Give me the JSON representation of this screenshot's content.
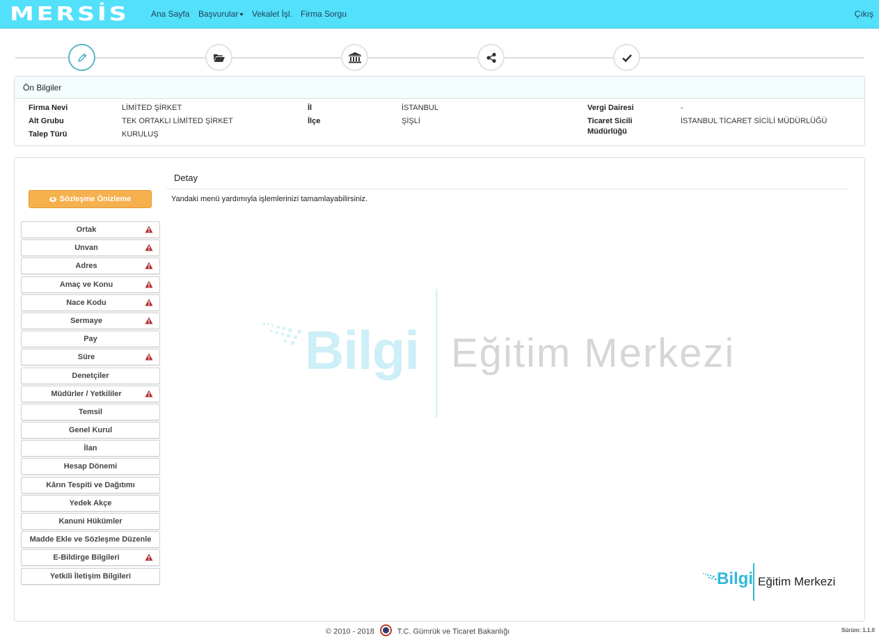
{
  "nav": {
    "logo": "MERSİS",
    "items": [
      "Ana Sayfa",
      "Başvurular",
      "Vekalet İşl.",
      "Firma Sorgu"
    ],
    "logout": "Çıkış"
  },
  "steps": [
    {
      "icon": "pencil-icon",
      "active": true
    },
    {
      "icon": "folder-open-icon",
      "active": false
    },
    {
      "icon": "bank-icon",
      "active": false
    },
    {
      "icon": "share-icon",
      "active": false
    },
    {
      "icon": "check-icon",
      "active": false
    }
  ],
  "on_bilgiler": {
    "title": "Ön Bilgiler",
    "firma_nevi_label": "Firma Nevi",
    "firma_nevi": "LİMİTED ŞİRKET",
    "alt_grubu_label": "Alt Grubu",
    "alt_grubu": "TEK ORTAKLI LİMİTED ŞİRKET",
    "talep_turu_label": "Talep Türü",
    "talep_turu": "KURULUŞ",
    "il_label": "İl",
    "il": "İSTANBUL",
    "ilce_label": "İlçe",
    "ilce": "ŞİŞLİ",
    "vergi_dairesi_label": "Vergi Dairesi",
    "vergi_dairesi": "-",
    "ticaret_sicili_label_1": "Ticaret Sicili",
    "ticaret_sicili_label_2": "Müdürlüğü",
    "ticaret_sicili": "İSTANBUL TİCARET SİCİLİ MÜDÜRLÜĞÜ"
  },
  "preview_button": "Sözleşme Önizleme",
  "menu": [
    {
      "label": "Ortak",
      "warning": true
    },
    {
      "label": "Unvan",
      "warning": true
    },
    {
      "label": "Adres",
      "warning": true
    },
    {
      "label": "Amaç ve Konu",
      "warning": true
    },
    {
      "label": "Nace Kodu",
      "warning": true
    },
    {
      "label": "Sermaye",
      "warning": true
    },
    {
      "label": "Pay",
      "warning": false
    },
    {
      "label": "Süre",
      "warning": true
    },
    {
      "label": "Denetçiler",
      "warning": false
    },
    {
      "label": "Müdürler / Yetkililer",
      "warning": true
    },
    {
      "label": "Temsil",
      "warning": false
    },
    {
      "label": "Genel Kurul",
      "warning": false
    },
    {
      "label": "İlan",
      "warning": false
    },
    {
      "label": "Hesap Dönemi",
      "warning": false
    },
    {
      "label": "Kârın Tespiti ve Dağıtımı",
      "warning": false
    },
    {
      "label": "Yedek Akçe",
      "warning": false
    },
    {
      "label": "Kanuni Hükümler",
      "warning": false
    },
    {
      "label": "Madde Ekle ve Sözleşme Düzenle",
      "warning": false
    },
    {
      "label": "E-Bildirge Bilgileri",
      "warning": true
    },
    {
      "label": "Yetkili İletişim Bilgileri",
      "warning": false
    }
  ],
  "detail": {
    "title": "Detay",
    "text": "Yandaki menü yardımıyla işlemlerinizi tamamlayabilirsiniz."
  },
  "watermark": {
    "brand": "Bilgi",
    "text": "Eğitim Merkezi"
  },
  "footer": {
    "copyright": "© 2010 - 2018",
    "ministry": "T.C. Gümrük ve Ticaret Bakanlığı",
    "version": "Sürüm: 1.1.0"
  },
  "colors": {
    "navbar": "#53e0fb",
    "preview_button": "#f6b04d",
    "warning": "#b03030",
    "active_step": "#5ab4c9"
  }
}
